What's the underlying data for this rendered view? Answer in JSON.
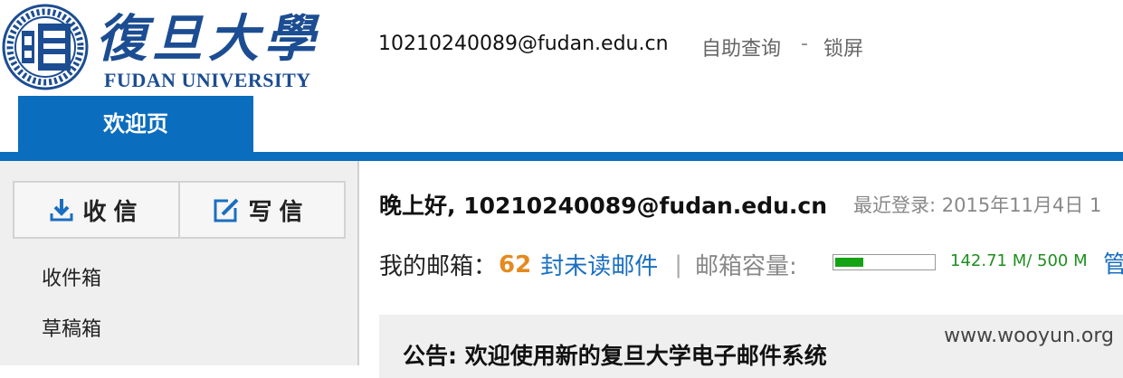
{
  "header": {
    "logo_cn": "復旦大學",
    "logo_en": "FUDAN UNIVERSITY",
    "user_email": "10210240089@fudan.edu.cn",
    "self_query": "自助查询",
    "separator": "-",
    "lock_screen": "锁屏",
    "welcome_tab": "欢迎页",
    "brand_color": "#0b6dbd"
  },
  "sidebar": {
    "receive_label": "收信",
    "compose_label": "写信",
    "items": [
      {
        "label": "收件箱"
      },
      {
        "label": "草稿箱"
      }
    ]
  },
  "main": {
    "greeting": "晚上好, 10210240089@fudan.edu.cn",
    "last_login": "最近登录: 2015年11月4日 1",
    "mailbox_label": "我的邮箱：",
    "unread_count": "62",
    "unread_suffix": "封未读邮件",
    "divider": "|",
    "capacity_label": "邮箱容量:",
    "capacity_used_fraction": 0.285,
    "capacity_text": "142.71 M/ 500 M",
    "manage_label": "管",
    "notice_title": "公告: 欢迎使用新的复旦大学电子邮件系统",
    "watermark": "www.wooyun.org"
  }
}
